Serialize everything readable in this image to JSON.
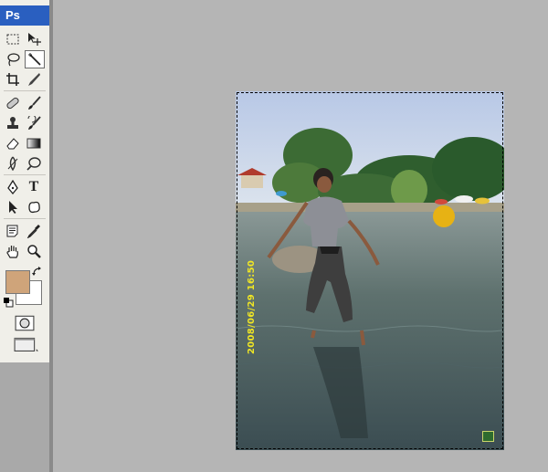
{
  "app": {
    "logo": "Ps"
  },
  "colors": {
    "foreground": "#cfa47a",
    "background": "#ffffff",
    "title_bar": "#2a5fc0",
    "workspace": "#b5b5b5"
  },
  "tools": [
    {
      "name": "rectangular-marquee-tool",
      "icon": "marquee-icon"
    },
    {
      "name": "move-tool",
      "icon": "move-icon"
    },
    {
      "name": "lasso-tool",
      "icon": "lasso-icon"
    },
    {
      "name": "magic-wand-tool",
      "icon": "magic-wand-icon",
      "active": true
    },
    {
      "name": "crop-tool",
      "icon": "crop-icon"
    },
    {
      "name": "slice-tool",
      "icon": "slice-icon"
    },
    {
      "name": "healing-brush-tool",
      "icon": "bandage-icon"
    },
    {
      "name": "brush-tool",
      "icon": "brush-icon"
    },
    {
      "name": "clone-stamp-tool",
      "icon": "stamp-icon"
    },
    {
      "name": "history-brush-tool",
      "icon": "history-brush-icon"
    },
    {
      "name": "eraser-tool",
      "icon": "eraser-icon"
    },
    {
      "name": "gradient-tool",
      "icon": "gradient-icon"
    },
    {
      "name": "blur-tool",
      "icon": "blur-icon"
    },
    {
      "name": "dodge-tool",
      "icon": "dodge-icon"
    },
    {
      "name": "pen-tool",
      "icon": "pen-icon"
    },
    {
      "name": "type-tool",
      "icon": "type-icon",
      "label": "T"
    },
    {
      "name": "path-selection-tool",
      "icon": "arrow-icon"
    },
    {
      "name": "custom-shape-tool",
      "icon": "shape-icon"
    },
    {
      "name": "notes-tool",
      "icon": "notes-icon"
    },
    {
      "name": "eyedropper-tool",
      "icon": "eyedropper-icon"
    },
    {
      "name": "hand-tool",
      "icon": "hand-icon"
    },
    {
      "name": "zoom-tool",
      "icon": "zoom-icon"
    }
  ],
  "document": {
    "date_stamp": "2008/06/29 16:50"
  }
}
